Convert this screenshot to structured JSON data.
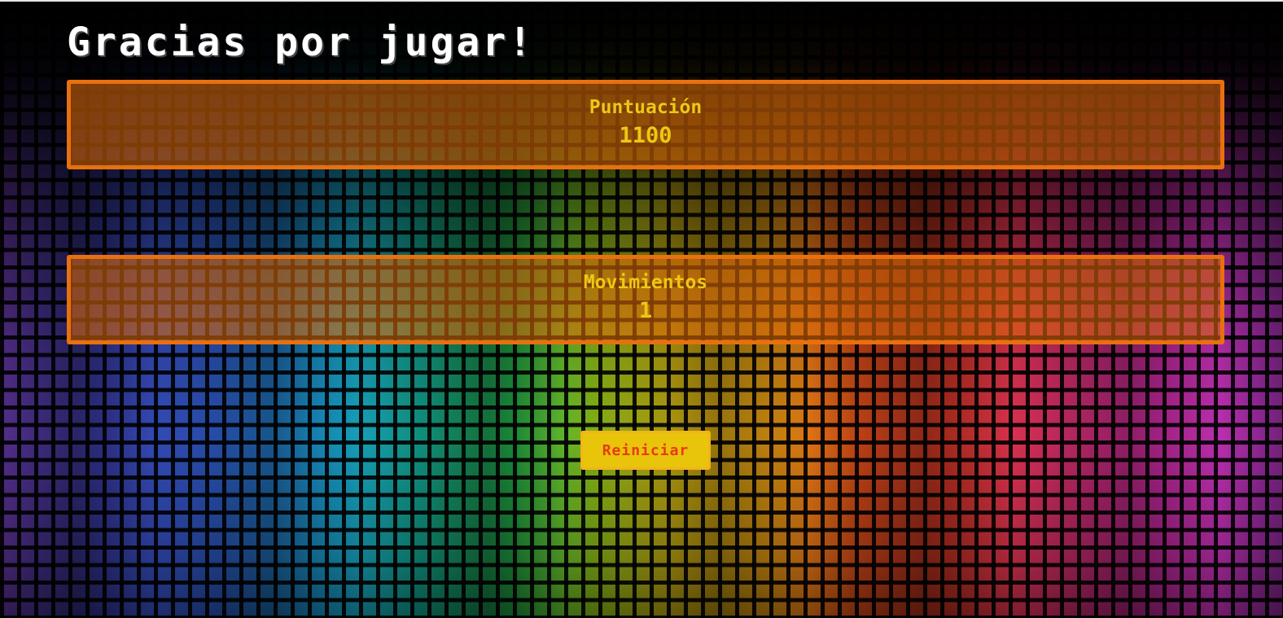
{
  "game_over": {
    "title": "Gracias por jugar!"
  },
  "stats": {
    "score": {
      "label": "Puntuación",
      "value": "1100"
    },
    "moves": {
      "label": "Movimientos",
      "value": "1"
    }
  },
  "actions": {
    "restart_label": "Reiniciar"
  },
  "colors": {
    "panel_border": "#e8700f",
    "stat_text": "#ecc816",
    "button_bg": "#e8c40a",
    "button_text": "#e83a14"
  }
}
